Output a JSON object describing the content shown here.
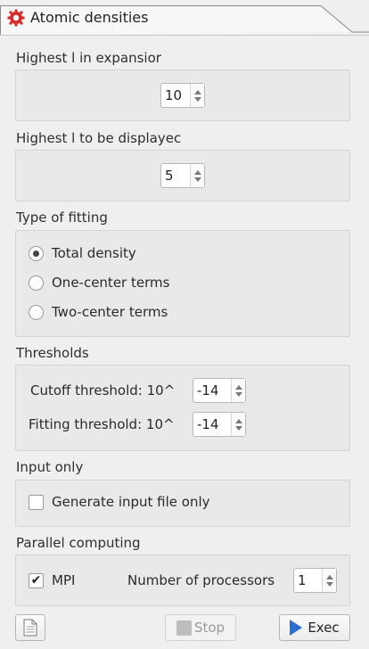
{
  "tab": {
    "title": "Atomic densities",
    "icon": "gear-icon",
    "icon_color": "#d62b2b"
  },
  "sections": {
    "expansion": {
      "label": "Highest l in expansior",
      "value": "10"
    },
    "displayed": {
      "label": "Highest l to be displayec",
      "value": "5"
    },
    "fitting": {
      "label": "Type of fitting",
      "options": [
        {
          "label": "Total density",
          "checked": true
        },
        {
          "label": "One-center terms",
          "checked": false
        },
        {
          "label": "Two-center terms",
          "checked": false
        }
      ]
    },
    "thresholds": {
      "label": "Thresholds",
      "cutoff_label": "Cutoff threshold: 10^",
      "cutoff_value": "-14",
      "fitting_label": "Fitting threshold: 10^",
      "fitting_value": "-14"
    },
    "input_only": {
      "label": "Input only",
      "checkbox_label": "Generate input file only",
      "checked": false
    },
    "parallel": {
      "label": "Parallel computing",
      "mpi_label": "MPI",
      "mpi_checked": true,
      "mpi_check_glyph": "✔",
      "procs_label": "Number of processors",
      "procs_value": "1"
    }
  },
  "buttons": {
    "stop": "Stop",
    "exec": "Exec"
  }
}
